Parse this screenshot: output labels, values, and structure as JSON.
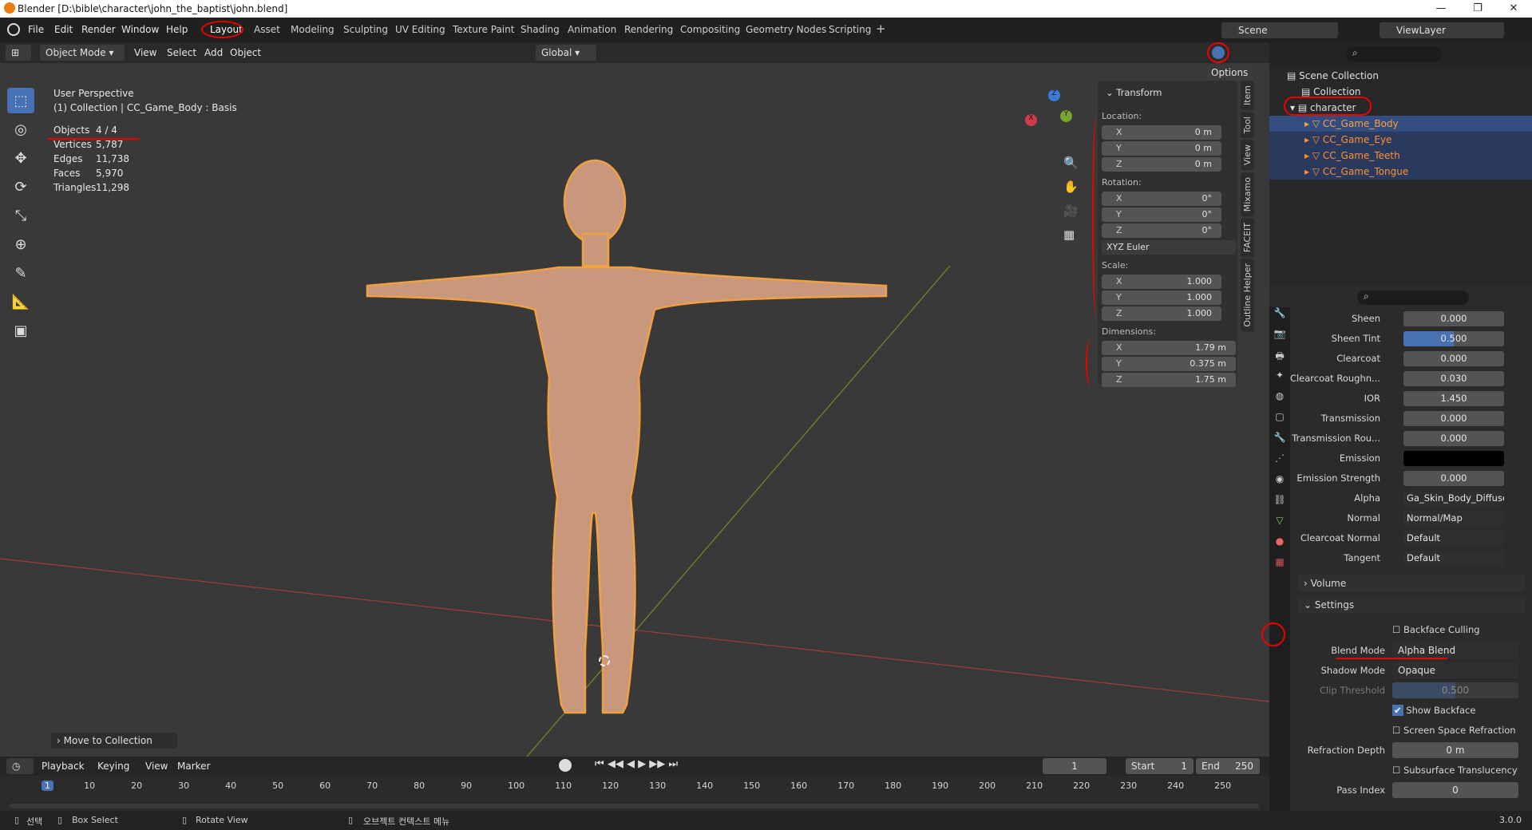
{
  "window": {
    "title": "Blender [D:\\bible\\character\\john_the_baptist\\john.blend]",
    "min": "—",
    "max": "❐",
    "close": "✕"
  },
  "menu": [
    "File",
    "Edit",
    "Render",
    "Window",
    "Help"
  ],
  "workspaces": [
    "Layout",
    "Asset",
    "Modeling",
    "Sculpting",
    "UV Editing",
    "Texture Paint",
    "Shading",
    "Animation",
    "Rendering",
    "Compositing",
    "Geometry Nodes",
    "Scripting",
    "+"
  ],
  "scene": {
    "scene": "Scene",
    "viewlayer": "ViewLayer"
  },
  "header": {
    "mode": "Object Mode",
    "view": "View",
    "select": "Select",
    "add": "Add",
    "object": "Object",
    "orientation": "Global",
    "options": "Options"
  },
  "overlay": {
    "perspective": "User Perspective",
    "collection": "(1) Collection | CC_Game_Body : Basis",
    "stats": [
      [
        "Objects",
        "4 / 4"
      ],
      [
        "Vertices",
        "5,787"
      ],
      [
        "Edges",
        "11,738"
      ],
      [
        "Faces",
        "5,970"
      ],
      [
        "Triangles",
        "11,298"
      ]
    ]
  },
  "npanel": {
    "title": "Transform",
    "location": "Location:",
    "rotation": "Rotation:",
    "scale": "Scale:",
    "dimensions": "Dimensions:",
    "loc": [
      [
        "X",
        "0 m"
      ],
      [
        "Y",
        "0 m"
      ],
      [
        "Z",
        "0 m"
      ]
    ],
    "rot": [
      [
        "X",
        "0°"
      ],
      [
        "Y",
        "0°"
      ],
      [
        "Z",
        "0°"
      ]
    ],
    "euler": "XYZ Euler",
    "scl": [
      [
        "X",
        "1.000"
      ],
      [
        "Y",
        "1.000"
      ],
      [
        "Z",
        "1.000"
      ]
    ],
    "dim": [
      [
        "X",
        "1.79 m"
      ],
      [
        "Y",
        "0.375 m"
      ],
      [
        "Z",
        "1.75 m"
      ]
    ]
  },
  "side_tabs": [
    "Item",
    "Tool",
    "View",
    "Mixamo",
    "FACEIT",
    "Outline Helper"
  ],
  "gizmo": {
    "x": "X",
    "y": "Y",
    "z": "Z"
  },
  "outliner": {
    "scene_collection": "Scene Collection",
    "collection": "Collection",
    "character": "character",
    "items": [
      "CC_Game_Body",
      "CC_Game_Eye",
      "CC_Game_Teeth",
      "CC_Game_Tongue"
    ]
  },
  "props": [
    {
      "label": "Sheen",
      "value": "0.000"
    },
    {
      "label": "Sheen Tint",
      "value": "0.500"
    },
    {
      "label": "Clearcoat",
      "value": "0.000"
    },
    {
      "label": "Clearcoat Roughn...",
      "value": "0.030"
    },
    {
      "label": "IOR",
      "value": "1.450"
    },
    {
      "label": "Transmission",
      "value": "0.000"
    },
    {
      "label": "Transmission Rou...",
      "value": "0.000"
    },
    {
      "label": "Emission",
      "value": ""
    },
    {
      "label": "Emission Strength",
      "value": "0.000"
    },
    {
      "label": "Alpha",
      "value": "Ga_Skin_Body_Diffuse..."
    },
    {
      "label": "Normal",
      "value": "Normal/Map"
    },
    {
      "label": "Clearcoat Normal",
      "value": "Default"
    },
    {
      "label": "Tangent",
      "value": "Default"
    }
  ],
  "panels": {
    "volume": "Volume",
    "settings": "Settings"
  },
  "settings": {
    "backface_culling": "Backface Culling",
    "blend_mode_label": "Blend Mode",
    "blend_mode": "Alpha Blend",
    "shadow_mode_label": "Shadow Mode",
    "shadow_mode": "Opaque",
    "clip_label": "Clip Threshold",
    "clip": "0.500",
    "show_backface": "Show Backface",
    "ssr": "Screen Space Refraction",
    "refr_label": "Refraction Depth",
    "refr": "0 m",
    "sss": "Subsurface Translucency",
    "pass_label": "Pass Index",
    "pass": "0"
  },
  "move_to_collection": "Move to Collection",
  "timeline": {
    "playback": "Playback",
    "keying": "Keying",
    "view": "View",
    "marker": "Marker",
    "frame": "1",
    "start_label": "Start",
    "start": "1",
    "end_label": "End",
    "end": "250",
    "ticks": [
      "1",
      "10",
      "20",
      "30",
      "40",
      "50",
      "60",
      "70",
      "80",
      "90",
      "100",
      "110",
      "120",
      "130",
      "140",
      "150",
      "160",
      "170",
      "180",
      "190",
      "200",
      "210",
      "220",
      "230",
      "240",
      "250"
    ]
  },
  "status": {
    "select": "선택",
    "box": "Box Select",
    "rotate": "Rotate View",
    "ctx": "오브젝트 컨텍스트 메뉴",
    "version": "3.0.0"
  }
}
